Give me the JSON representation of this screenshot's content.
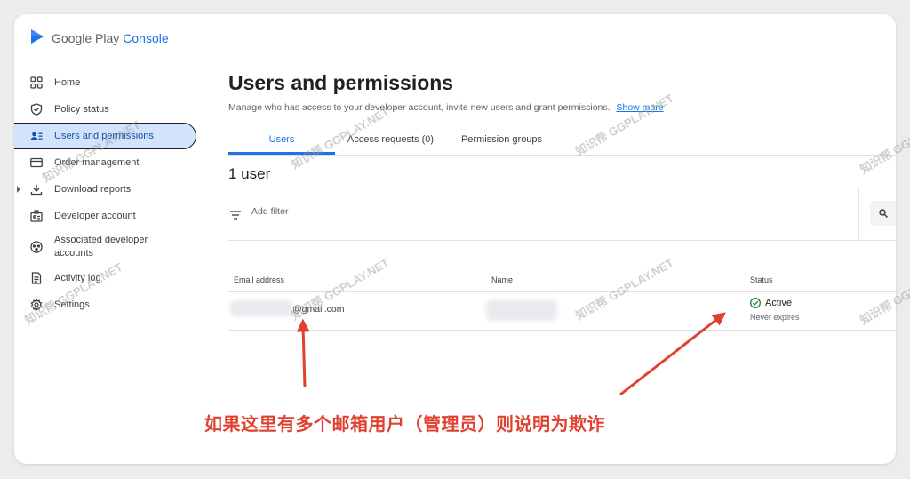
{
  "app": {
    "logo_part1": "Google Play",
    "logo_part2": "Console"
  },
  "sidebar": {
    "items": [
      {
        "label": "Home",
        "icon": "grid-icon"
      },
      {
        "label": "Policy status",
        "icon": "shield-icon"
      },
      {
        "label": "Users and permissions",
        "icon": "users-icon",
        "active": true
      },
      {
        "label": "Order management",
        "icon": "credit-card-icon"
      },
      {
        "label": "Download reports",
        "icon": "download-icon"
      },
      {
        "label": "Developer account",
        "icon": "badge-icon"
      },
      {
        "label": "Associated developer accounts",
        "icon": "linked-accounts-icon"
      },
      {
        "label": "Activity log",
        "icon": "document-icon"
      },
      {
        "label": "Settings",
        "icon": "gear-icon"
      }
    ]
  },
  "main": {
    "title": "Users and permissions",
    "subtitle": "Manage who has access to your developer account, invite new users and grant permissions.",
    "show_more": "Show more",
    "tabs": [
      {
        "label": "Users",
        "selected": true
      },
      {
        "label": "Access requests (0)"
      },
      {
        "label": "Permission groups"
      }
    ],
    "user_count": "1 user",
    "filter_placeholder": "Add filter",
    "table": {
      "columns": [
        "Email address",
        "Name",
        "Status"
      ],
      "rows": [
        {
          "email": "@gmail.com",
          "name": "",
          "status": "Active",
          "expiry": "Never expires"
        }
      ]
    }
  },
  "annotation": {
    "text": "如果这里有多个邮箱用户（管理员）则说明为欺诈",
    "color": "#e0412f"
  },
  "watermark": "知识帮 GGPLAY.NET",
  "colors": {
    "accent": "#1a73e8",
    "active_bg": "#d2e3fc",
    "status_ok": "#188038"
  }
}
